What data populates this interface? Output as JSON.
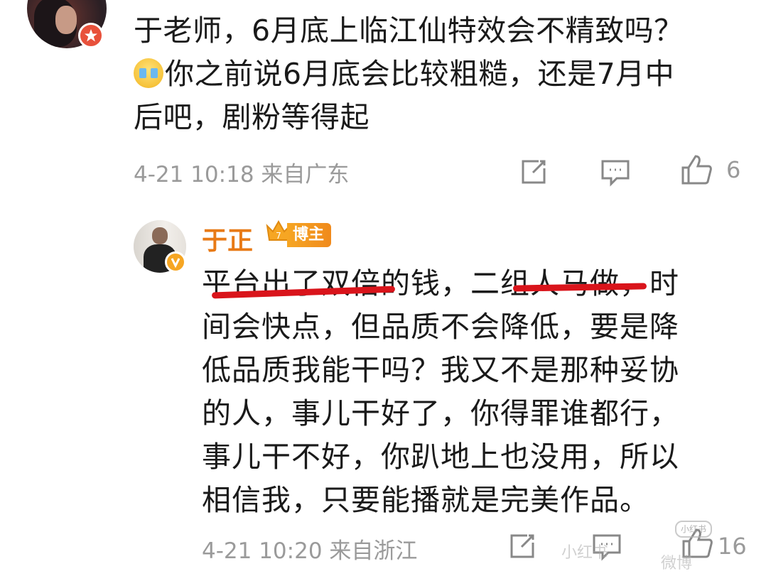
{
  "comment": {
    "lines": [
      "于老师，6月底上临江仙特效会不精致吗？",
      "你之前说6月底会比较粗糙，还是7月中",
      "后吧，剧粉等得起"
    ],
    "meta": "4-21 10:18  来自广东",
    "like_count": "6",
    "emoji_icon": "crying-face-icon",
    "badge_color": "#e8513b"
  },
  "reply": {
    "author": "于正",
    "tag": "博主",
    "crown_level": "7",
    "lines": [
      "平台出了双倍的钱，二组人马做，时",
      "间会快点，但品质不会降低，要是降",
      "低品质我能干吗？我又不是那种妥协",
      "的人，事儿干好了，你得罪谁都行，",
      "事儿干不好，你趴地上也没用，所以",
      "相信我，只要能播就是完美作品。"
    ],
    "meta": "4-21 10:20  来自浙江",
    "like_count": "16",
    "author_color": "#e87a16",
    "underline_color": "#d9141b"
  },
  "watermark": {
    "logo": "小红书",
    "text_1": "小红书",
    "text_2": "微博"
  }
}
